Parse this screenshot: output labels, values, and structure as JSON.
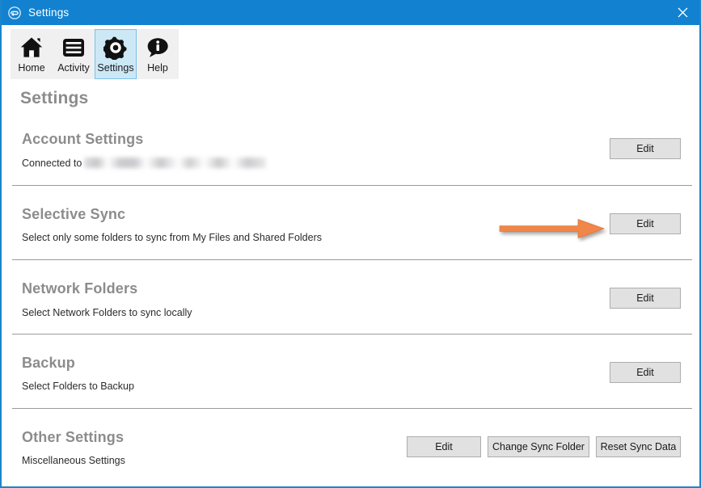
{
  "window": {
    "title": "Settings",
    "title_icon": "sync-circle-icon",
    "close_icon": "close-icon",
    "accent_color": "#1281d0",
    "titlebar_bg": "#1281d0",
    "border_color": "#1c86cb"
  },
  "toolbar": {
    "items": [
      {
        "label": "Home",
        "icon": "home-icon",
        "active": false
      },
      {
        "label": "Activity",
        "icon": "activity-icon",
        "active": false
      },
      {
        "label": "Settings",
        "icon": "gear-icon",
        "active": true
      },
      {
        "label": "Help",
        "icon": "help-icon",
        "active": false
      }
    ],
    "active_bg": "#cce8f7",
    "active_border": "#7cc0e8"
  },
  "page": {
    "title": "Settings"
  },
  "sections": [
    {
      "heading": "Account Settings",
      "subtext": "Connected to",
      "subtext_redacted": true,
      "buttons": [
        {
          "label": "Edit"
        }
      ]
    },
    {
      "heading": "Selective Sync",
      "subtext": "Select only some folders to sync from My Files and Shared Folders",
      "subtext_redacted": false,
      "buttons": [
        {
          "label": "Edit"
        }
      ],
      "annotated": true
    },
    {
      "heading": "Network Folders",
      "subtext": "Select Network Folders to sync locally",
      "subtext_redacted": false,
      "buttons": [
        {
          "label": "Edit"
        }
      ]
    },
    {
      "heading": "Backup",
      "subtext": "Select Folders to Backup",
      "subtext_redacted": false,
      "buttons": [
        {
          "label": "Edit"
        }
      ]
    },
    {
      "heading": "Other Settings",
      "subtext": "Miscellaneous Settings",
      "subtext_redacted": false,
      "buttons": [
        {
          "label": "Edit"
        },
        {
          "label": "Change Sync Folder"
        },
        {
          "label": "Reset Sync Data"
        }
      ]
    }
  ],
  "annotation": {
    "type": "arrow",
    "direction": "right",
    "color": "#f0864a",
    "target": "selective-sync-edit-button"
  },
  "button_style": {
    "background": "#e1e1e1",
    "border": "#adadad"
  }
}
